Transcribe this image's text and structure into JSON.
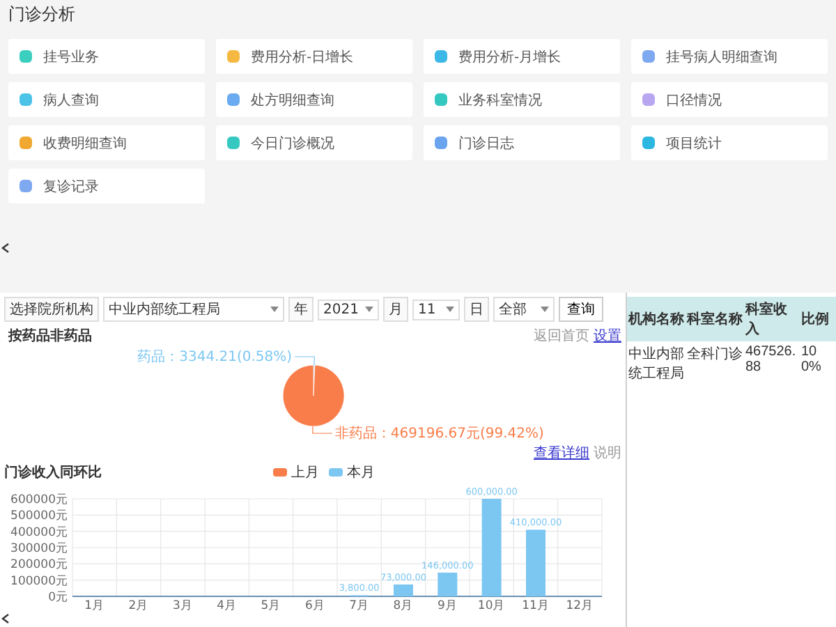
{
  "page_title": "门诊分析",
  "tiles": [
    {
      "label": "挂号业务",
      "color": "#3ccfc0"
    },
    {
      "label": "费用分析-日增长",
      "color": "#f5b942"
    },
    {
      "label": "费用分析-月增长",
      "color": "#3cb8e6"
    },
    {
      "label": "挂号病人明细查询",
      "color": "#7ea8f0"
    },
    {
      "label": "病人查询",
      "color": "#4cc4e8"
    },
    {
      "label": "处方明细查询",
      "color": "#6aaaf0"
    },
    {
      "label": "业务科室情况",
      "color": "#34c8c0"
    },
    {
      "label": "口径情况",
      "color": "#b9a6f0"
    },
    {
      "label": "收费明细查询",
      "color": "#f0a830"
    },
    {
      "label": "今日门诊概况",
      "color": "#34c8c0"
    },
    {
      "label": "门诊日志",
      "color": "#6aa4ee"
    },
    {
      "label": "项目统计",
      "color": "#2cb8e0"
    },
    {
      "label": "复诊记录",
      "color": "#7ea8f0"
    }
  ],
  "filters": {
    "org_label": "选择院所机构",
    "org_value": "中业内部统工程局",
    "year_label": "年",
    "year": "2021",
    "month_label": "月",
    "month": "11",
    "day_label": "日",
    "day": "全部",
    "query_button": "查询"
  },
  "pie_panel": {
    "title": "按药品非药品",
    "links": [
      "返回首页",
      "设置"
    ],
    "chart_data": {
      "type": "pie",
      "categories": [
        "药品",
        "非药品"
      ],
      "values": [
        3344.21,
        469196.67
      ],
      "colors": [
        "#7cc6f2",
        "#f97d4a"
      ],
      "value_labels": [
        "：3344.21(0.58%)",
        "：469196.67元(99.42%)"
      ]
    },
    "footer_links": [
      "查看详细",
      "说明"
    ]
  },
  "bar_panel": {
    "title": "门诊收入同环比",
    "chart_data": {
      "type": "bar",
      "categories": [
        "1月",
        "2月",
        "3月",
        "4月",
        "5月",
        "6月",
        "7月",
        "8月",
        "9月",
        "10月",
        "11月",
        "12月"
      ],
      "grid": true,
      "series": [
        {
          "name": "上月",
          "color": "#f97d4a",
          "values": [
            null,
            null,
            null,
            null,
            null,
            null,
            null,
            null,
            null,
            null,
            null,
            null
          ]
        },
        {
          "name": "本月",
          "color": "#7cc6f2",
          "values": [
            null,
            null,
            null,
            null,
            null,
            null,
            3800,
            73000,
            146000,
            600000,
            410000,
            null
          ]
        }
      ],
      "ylim": [
        0,
        600000
      ],
      "yticks": [
        {
          "value": 0,
          "label": "0元"
        },
        {
          "value": 100000,
          "label": "100000元"
        },
        {
          "value": 200000,
          "label": "200000元"
        },
        {
          "value": 300000,
          "label": "300000元"
        },
        {
          "value": 400000,
          "label": "400000元"
        },
        {
          "value": 500000,
          "label": "500000元"
        },
        {
          "value": 600000,
          "label": "600000元"
        }
      ],
      "value_labels": [
        null,
        null,
        null,
        null,
        null,
        null,
        "3,800.00",
        "73,000.00",
        "146,000.00",
        "600,000.00",
        "410,000.00",
        null
      ]
    }
  },
  "table": {
    "columns": [
      "机构名称",
      "科室名称",
      "科室收入",
      "比例"
    ],
    "rows": [
      [
        "中业内部统工程局",
        "全科门诊",
        "467526.88",
        "100%"
      ]
    ]
  }
}
